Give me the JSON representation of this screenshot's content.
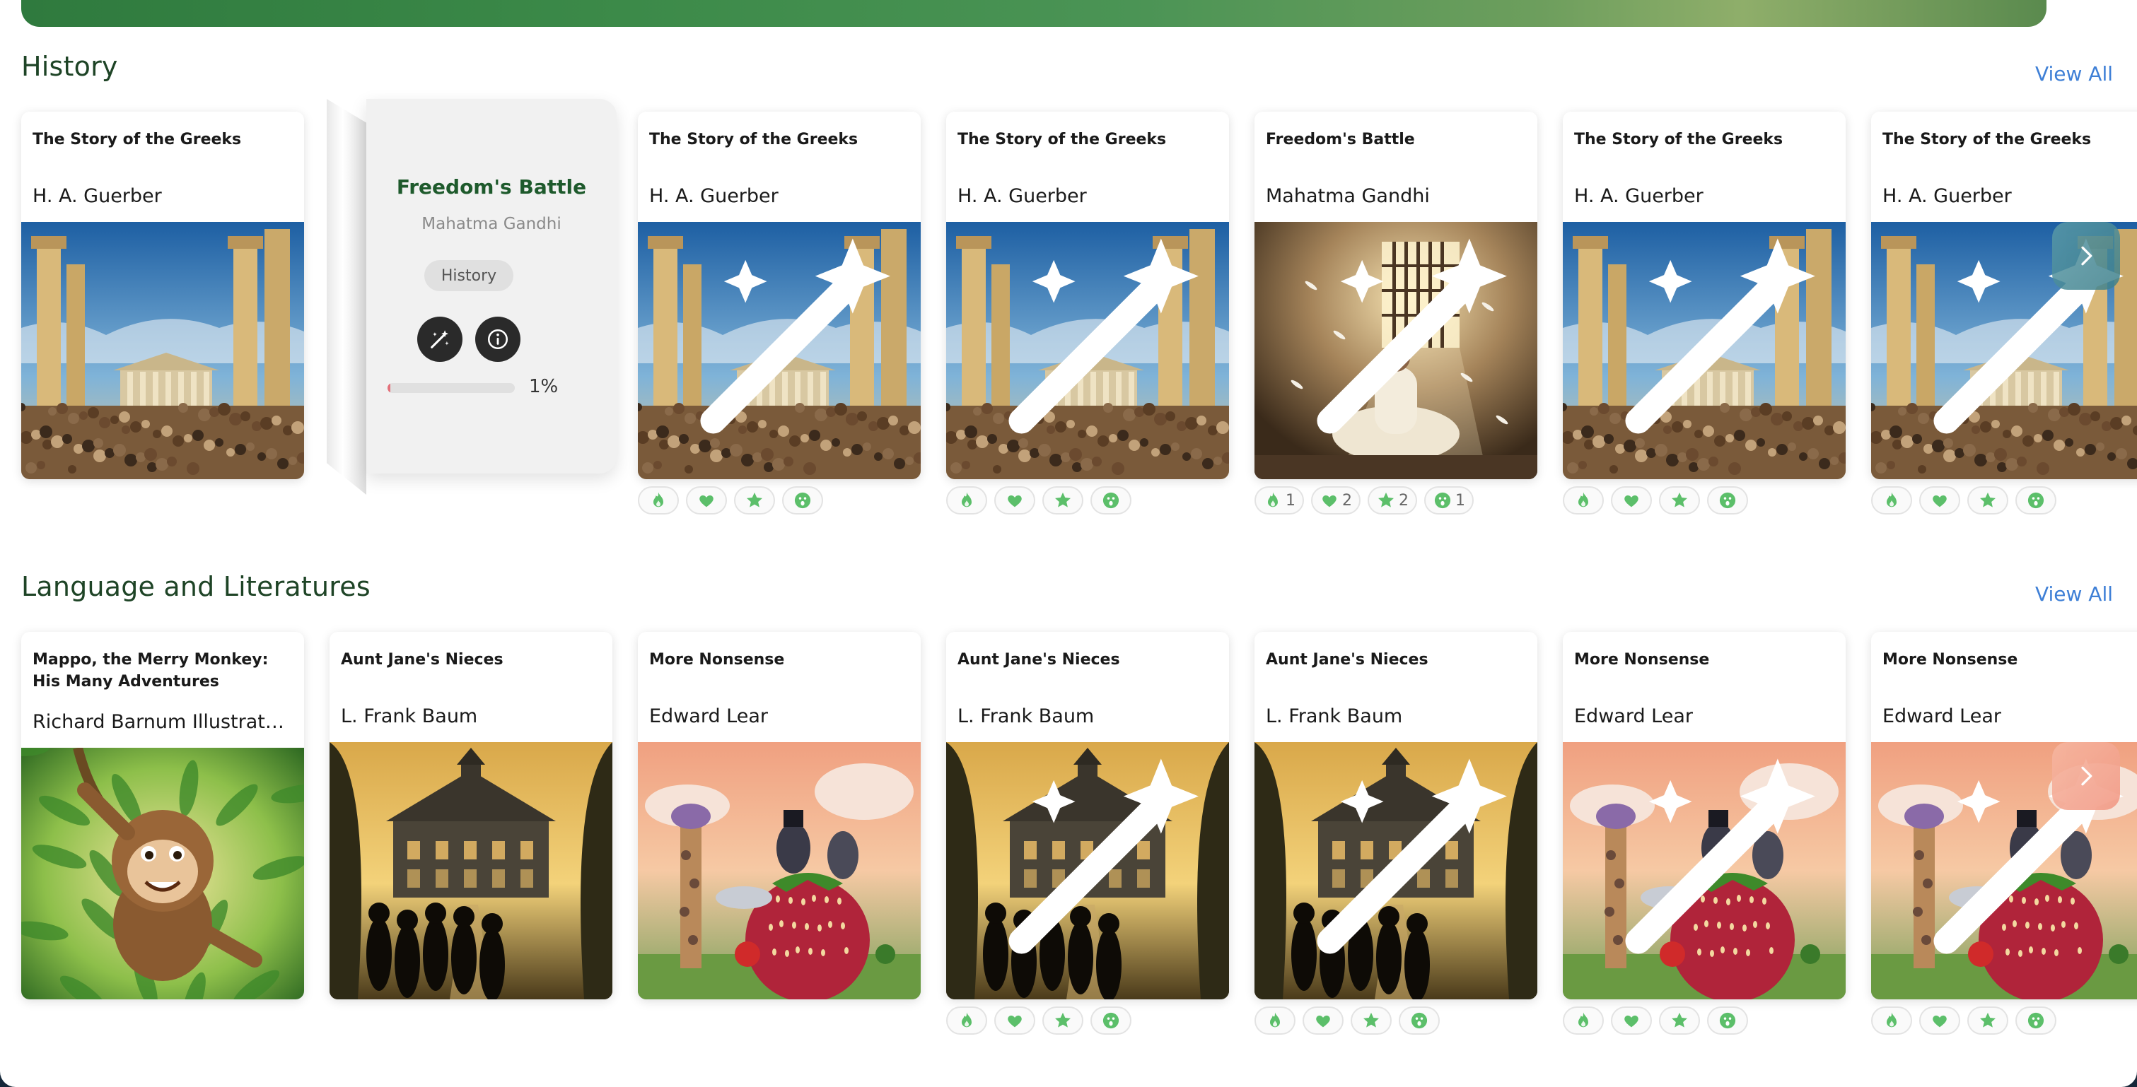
{
  "colors": {
    "accent": "#2f7a3e",
    "link": "#3e7fd6",
    "reaction_green": "#5cbf6a",
    "progress": "#e4707a"
  },
  "sections": [
    {
      "title": "History",
      "view_all": "View All",
      "flipped_card": {
        "title": "Freedom's Battle",
        "author": "Mahatma Gandhi",
        "tag": "History",
        "progress_percent": 1,
        "progress_label": "1%"
      },
      "cards": [
        {
          "title": "The Story of the Greeks",
          "author": "H. A. Guerber",
          "image": "greek-agora",
          "reactions": null
        },
        {
          "title": "The Story of the Greeks",
          "author": "H. A. Guerber",
          "image": "greek-agora",
          "reactions": [
            "",
            "",
            "",
            ""
          ]
        },
        {
          "title": "The Story of the Greeks",
          "author": "H. A. Guerber",
          "image": "greek-agora",
          "reactions": [
            "",
            "",
            "",
            ""
          ]
        },
        {
          "title": "Freedom's Battle",
          "author": "Mahatma Gandhi",
          "image": "gandhi-cell",
          "reactions": [
            "1",
            "2",
            "2",
            "1"
          ]
        },
        {
          "title": "The Story of the Greeks",
          "author": "H. A. Guerber",
          "image": "greek-agora",
          "reactions": [
            "",
            "",
            "",
            ""
          ]
        },
        {
          "title": "The Story of the Greeks",
          "author": "H. A. Guerber",
          "image": "greek-agora",
          "reactions": [
            "",
            "",
            "",
            ""
          ]
        }
      ]
    },
    {
      "title": "Language and Literatures",
      "view_all": "View All",
      "cards": [
        {
          "title": "Mappo, the Merry Monkey: His Many Adventures",
          "author": "Richard Barnum Illustrator:...",
          "image": "monkey-jungle",
          "reactions": null
        },
        {
          "title": "Aunt Jane's Nieces",
          "author": "L. Frank Baum",
          "image": "mansion-silhouettes",
          "reactions": null
        },
        {
          "title": "More Nonsense",
          "author": "Edward Lear",
          "image": "giraffe-strawberry",
          "reactions": null
        },
        {
          "title": "Aunt Jane's Nieces",
          "author": "L. Frank Baum",
          "image": "mansion-silhouettes",
          "reactions": [
            "",
            "",
            "",
            ""
          ]
        },
        {
          "title": "Aunt Jane's Nieces",
          "author": "L. Frank Baum",
          "image": "mansion-silhouettes",
          "reactions": [
            "",
            "",
            "",
            ""
          ]
        },
        {
          "title": "More Nonsense",
          "author": "Edward Lear",
          "image": "giraffe-strawberry",
          "reactions": [
            "",
            "",
            "",
            ""
          ]
        },
        {
          "title": "More Nonsense",
          "author": "Edward Lear",
          "image": "giraffe-strawberry",
          "reactions": [
            "",
            "",
            "",
            ""
          ]
        }
      ]
    }
  ],
  "reaction_icons": [
    "fire-icon",
    "heart-icon",
    "star-icon",
    "surprised-face-icon"
  ]
}
